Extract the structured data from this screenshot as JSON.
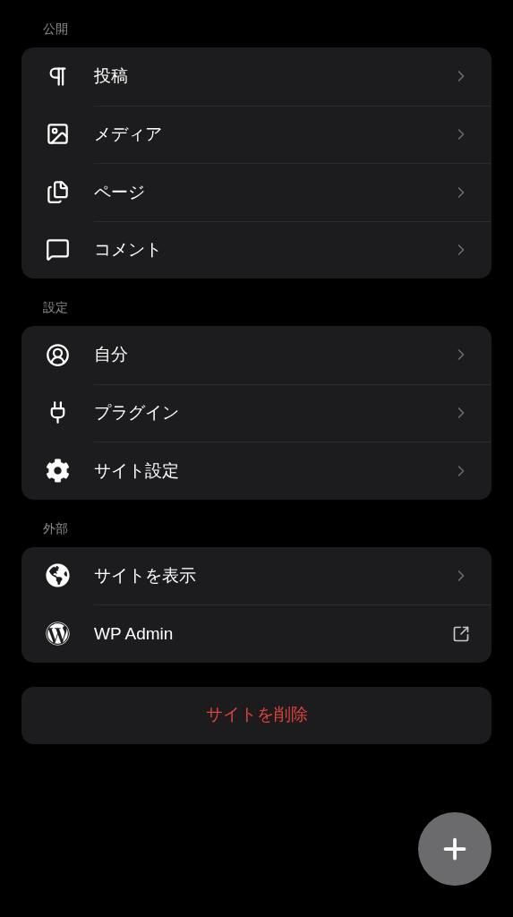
{
  "sections": [
    {
      "title": "公開",
      "items": [
        {
          "label": "投稿",
          "kind": "chevron"
        },
        {
          "label": "メディア",
          "kind": "chevron"
        },
        {
          "label": "ページ",
          "kind": "chevron"
        },
        {
          "label": "コメント",
          "kind": "chevron"
        }
      ]
    },
    {
      "title": "設定",
      "items": [
        {
          "label": "自分",
          "kind": "chevron"
        },
        {
          "label": "プラグイン",
          "kind": "chevron"
        },
        {
          "label": "サイト設定",
          "kind": "chevron"
        }
      ]
    },
    {
      "title": "外部",
      "items": [
        {
          "label": "サイトを表示",
          "kind": "chevron"
        },
        {
          "label": "WP Admin",
          "kind": "external"
        }
      ]
    }
  ],
  "delete_button": {
    "label": "サイトを削除"
  }
}
